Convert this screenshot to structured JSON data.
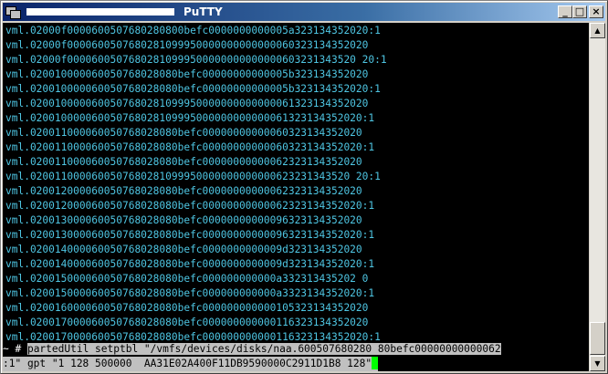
{
  "window": {
    "title": "PuTTY",
    "buttons": {
      "minimize": "_",
      "maximize": "□",
      "close": "×"
    }
  },
  "terminal": {
    "lines": [
      "vml.02000f0000600507680280800befc0000000000005a323134352020:1",
      "vml.02000f0000600507680281099950000000000000060323134352020",
      "vml.02000f00006005076802810999500000000000000603231343520 20:1",
      "vml.020010000060050768028080befc00000000000005b323134352020",
      "vml.020010000060050768028080befc00000000000005b323134352020:1",
      "vml.0200100000600507680281099950000000000000061323134352020",
      "vml.020010000060050768028109995000000000000061323134352020:1",
      "vml.020011000060050768028080befc00000000000060323134352020",
      "vml.020011000060050768028080befc00000000000060323134352020:1",
      "vml.020011000060050768028080befc00000000000062323134352020",
      "vml.0200110000600507680281099950000000000000623231343520 20:1",
      "vml.020012000060050768028080befc00000000000062323134352020",
      "vml.020012000060050768028080befc00000000000062323134352020:1",
      "vml.020013000060050768028080befc00000000000096323134352020",
      "vml.020013000060050768028080befc00000000000096323134352020:1",
      "vml.020014000060050768028080befc0000000000009d323134352020",
      "vml.020014000060050768028080befc0000000000009d323134352020:1",
      "vml.020015000060050768028080befc000000000000a332313435202 0",
      "vml.020015000060050768028080befc000000000000a3323134352020:1",
      "vml.020016000060050768028080befc000000000000105323134352020",
      "vml.020017000060050768028080befc000000000000116323134352020",
      "vml.020017000060050768028080befc000000000000116323134352020:1"
    ],
    "prompt": "~ # ",
    "command_line1": "partedUtil setptbl \"/vmfs/devices/disks/naa.600507680280 80befc00000000000062",
    "command_line2": ":1\" gpt \"1 128 500000  AA31E02A400F11DB9590000C2911D1B8 128\""
  },
  "colors": {
    "terminal_bg": "#000000",
    "terminal_text": "#4ec5e2",
    "cursor": "#00ff00",
    "selection_bg": "#c0c0c0"
  }
}
